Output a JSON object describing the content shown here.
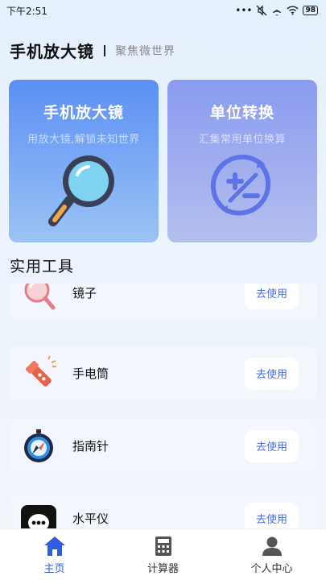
{
  "status_bar": {
    "time": "下午2:51",
    "battery": "98"
  },
  "header": {
    "title": "手机放大镜",
    "subtitle": "聚焦微世界"
  },
  "feature_cards": [
    {
      "title": "手机放大镜",
      "desc": "用放大镜,解锁未知世界",
      "icon": "magnifier-icon"
    },
    {
      "title": "单位转换",
      "desc": "汇集常用单位换算",
      "icon": "unit-convert-icon"
    }
  ],
  "section": {
    "title": "实用工具"
  },
  "tools": [
    {
      "name": "镜子",
      "button": "去使用",
      "icon": "mirror-icon"
    },
    {
      "name": "手电筒",
      "button": "去使用",
      "icon": "flashlight-icon"
    },
    {
      "name": "指南针",
      "button": "去使用",
      "icon": "compass-icon"
    },
    {
      "name": "水平仪",
      "button": "去使用",
      "icon": "level-icon"
    }
  ],
  "bottom_nav": [
    {
      "label": "主页",
      "icon": "home-icon",
      "active": true
    },
    {
      "label": "计算器",
      "icon": "calculator-icon",
      "active": false
    },
    {
      "label": "个人中心",
      "icon": "person-icon",
      "active": false
    }
  ],
  "colors": {
    "accent": "#2f5fe0",
    "button_text": "#4a6ee0",
    "card_blue": "#5b8ff5",
    "card_purple": "#8a9bf0"
  }
}
